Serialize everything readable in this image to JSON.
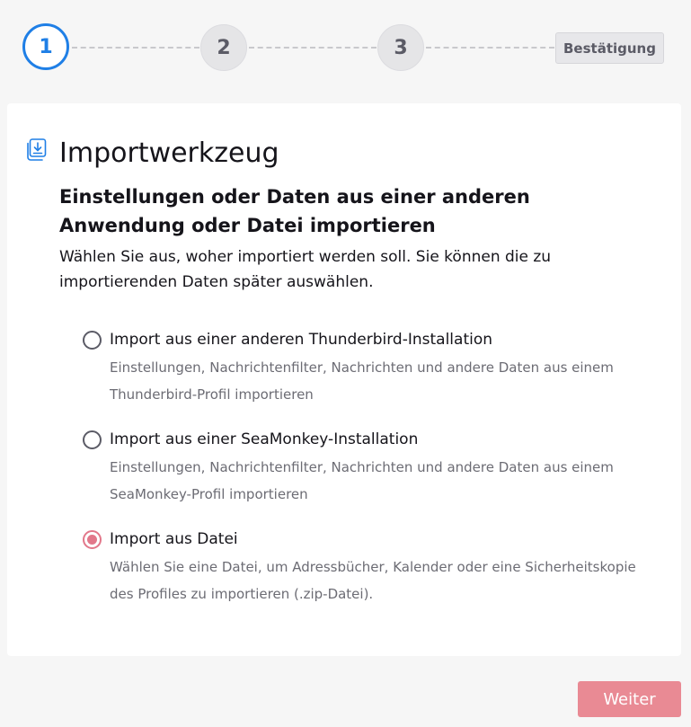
{
  "stepper": {
    "steps": [
      "1",
      "2",
      "3"
    ],
    "confirm_label": "Bestätigung",
    "active_color": "#1f7fe6"
  },
  "header": {
    "icon": "import-icon",
    "title": "Importwerkzeug",
    "subtitle": "Einstellungen oder Daten aus einer anderen Anwendung oder Datei importieren",
    "description": "Wählen Sie aus, woher importiert werden soll. Sie können die zu importierenden Daten später auswählen."
  },
  "options": [
    {
      "label": "Import aus einer anderen Thunderbird-Installation",
      "description": "Einstellungen, Nachrichtenfilter, Nachrichten und andere Daten aus einem Thunderbird-Profil importieren",
      "checked": false
    },
    {
      "label": "Import aus einer SeaMonkey-Installation",
      "description": "Einstellungen, Nachrichtenfilter, Nachrichten und andere Daten aus einem SeaMonkey-Profil importieren",
      "checked": false
    },
    {
      "label": "Import aus Datei",
      "description": "Wählen Sie eine Datei, um Adressbücher, Kalender oder eine Sicherheitskopie des Profiles zu importieren (.zip-Datei).",
      "checked": true
    }
  ],
  "footer": {
    "next_label": "Weiter",
    "accent_color": "#e98a94"
  }
}
